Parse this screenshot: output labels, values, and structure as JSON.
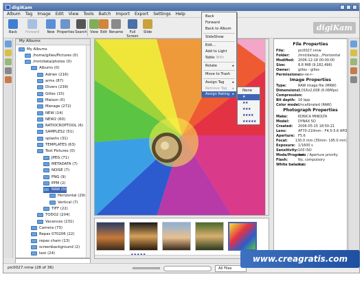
{
  "window": {
    "title": "digiKam"
  },
  "menubar": [
    "Album",
    "Tag",
    "Image",
    "Edit",
    "View",
    "Tools",
    "Batch",
    "Import",
    "Export",
    "Settings",
    "Help"
  ],
  "toolbar": {
    "buttons": [
      "Back",
      "Forward",
      "New",
      "Properties",
      "Search",
      "View",
      "Edit",
      "Rename",
      "Full Screen",
      "Slide"
    ],
    "logo_text": "digiKam"
  },
  "tree": {
    "header": "My Albums",
    "items": [
      "My Albums",
      "/home/gilles/Pictures (0)",
      "/mnt/data/photos (0)",
      "Albums (0)",
      "Adrien (216)",
      "arms (87)",
      "Divers (239)",
      "Gilles (15)",
      "Maison (0)",
      "Manage (272)",
      "NEW (14)",
      "NEW2 (60)",
      "RATIOCROPTOOL (6)",
      "SAMPLES2 (51)",
      "splashs (31)",
      "TEMPLATES (63)",
      "Test Pictures (0)",
      "JPEG (71)",
      "METADATA (7)",
      "NOISE (7)",
      "PNG (9)",
      "PPM (2)",
      "RAW (0)",
      "Horizontal (29)",
      "Vertical (7)",
      "TIFF (22)",
      "TODO2 (204)",
      "Vacances (231)",
      "Camera (73)",
      "Repas 070206 (22)",
      "repas cham (13)",
      "screenbackground (2)",
      "test (24)"
    ],
    "search_placeholder": ""
  },
  "context_menu": {
    "items": [
      "Back",
      "Forward",
      "Back to Album",
      "SlideShow",
      "Edit...",
      "Add to Light Table",
      "Open With",
      "Rotate",
      "Move to Trash",
      "Assign Tag",
      "Remove Tag",
      "Assign Rating"
    ],
    "submenu_items": [
      "None",
      "★",
      "★★",
      "★★★",
      "★★★★",
      "★★★★★"
    ]
  },
  "thumbnails": {
    "rating": "★★★★★"
  },
  "properties": {
    "file": {
      "title": "File Properties",
      "rows": [
        [
          "File:",
          "pic0027.nmw"
        ],
        [
          "Folder:",
          "/mnt/data/p.../Horizontal"
        ],
        [
          "Modified:",
          "2006-12-18 00:00:00"
        ],
        [
          "Size:",
          "8.8 MiB (9,182,496)"
        ],
        [
          "Owner:",
          "gilles - gilles"
        ],
        [
          "Permissions:",
          "-rw-rw-r--"
        ]
      ]
    },
    "image": {
      "title": "Image Properties",
      "rows": [
        [
          "Type:",
          "RAW image file (MRW)"
        ],
        [
          "Dimensions:",
          "3,016x2,008 (6.06Mpx)"
        ],
        [
          "Compression:",
          ""
        ],
        [
          "Bit depth:",
          "16 bpp"
        ],
        [
          "Color mode:",
          "Uncalibrated (RAW)"
        ]
      ]
    },
    "photo": {
      "title": "Photograph Properties",
      "rows": [
        [
          "Make:",
          "KONICA MINOLTA"
        ],
        [
          "Model:",
          "DYNAX 5D"
        ],
        [
          "Created:",
          "2006-05-15 18:50:21"
        ],
        [
          "Lens:",
          "AF70-210mm - F4.5-5.6 APO"
        ],
        [
          "Aperture:",
          "F5.6"
        ],
        [
          "Focal:",
          "130.0 mm (35mm: 195.0 mm)"
        ],
        [
          "Exposure:",
          "1/1600 s"
        ],
        [
          "Sensitivity:",
          "100 ISO"
        ],
        [
          "Mode/Program:",
          "Auto / Aperture priority"
        ],
        [
          "Flash:",
          "No, compulsory"
        ],
        [
          "White balance:",
          "Auto"
        ]
      ]
    }
  },
  "statusbar": {
    "left_text": "pic0027.nmw (28 of 36)",
    "filter": "All Files"
  },
  "watermark": "www.creagratis.com"
}
